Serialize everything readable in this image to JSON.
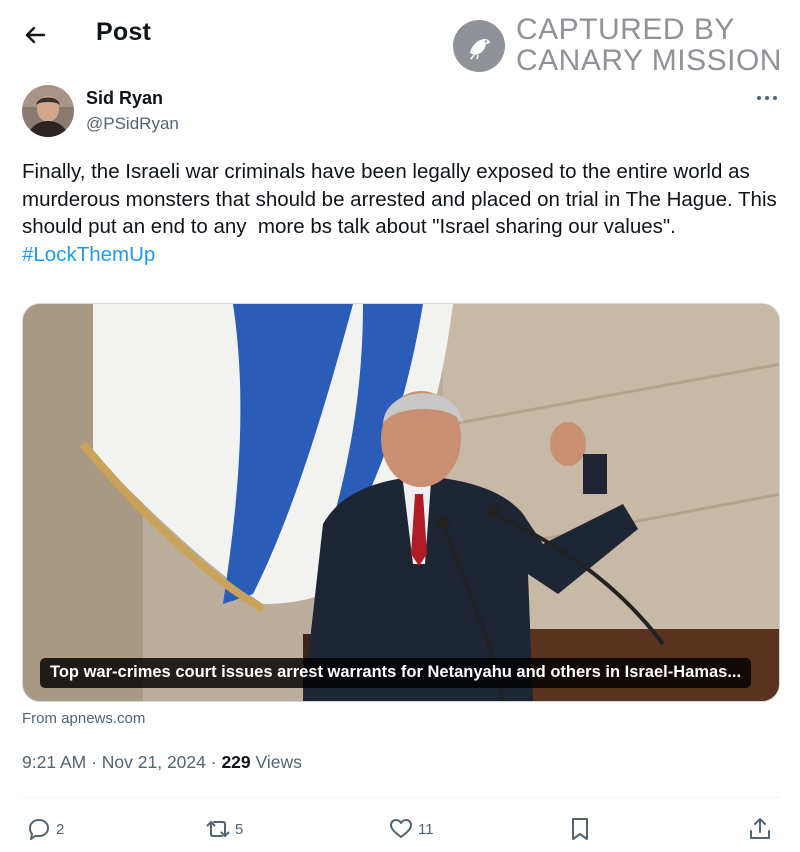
{
  "header": {
    "title": "Post",
    "watermark_line1": "CAPTURED BY",
    "watermark_line2": "CANARY MISSION"
  },
  "author": {
    "name": "Sid Ryan",
    "handle": "@PSidRyan"
  },
  "tweet": {
    "text": "Finally, the Israeli war criminals have been legally exposed to the entire world as murderous monsters that should be arrested and placed on trial in The Hague. This should put an end to any  more bs talk about \"Israel sharing our values\". ",
    "hashtag": "#LockThemUp"
  },
  "media": {
    "caption": "Top war-crimes court issues arrest warrants for Netanyahu and others in Israel-Hamas...",
    "source": "From apnews.com"
  },
  "meta": {
    "time": "9:21 AM",
    "separator": " · ",
    "date": "Nov 21, 2024",
    "views_count": "229",
    "views_label": " Views"
  },
  "actions": {
    "replies": "2",
    "reposts": "5",
    "likes": "11"
  },
  "icons": {
    "back": "arrow-left-icon",
    "more": "more-dots-icon",
    "reply": "reply-icon",
    "repost": "repost-icon",
    "like": "heart-icon",
    "bookmark": "bookmark-icon",
    "share": "share-icon"
  },
  "colors": {
    "link": "#1d9bf0",
    "secondary_text": "#536471",
    "primary_text": "#0f1419",
    "watermark": "#8f9296"
  }
}
